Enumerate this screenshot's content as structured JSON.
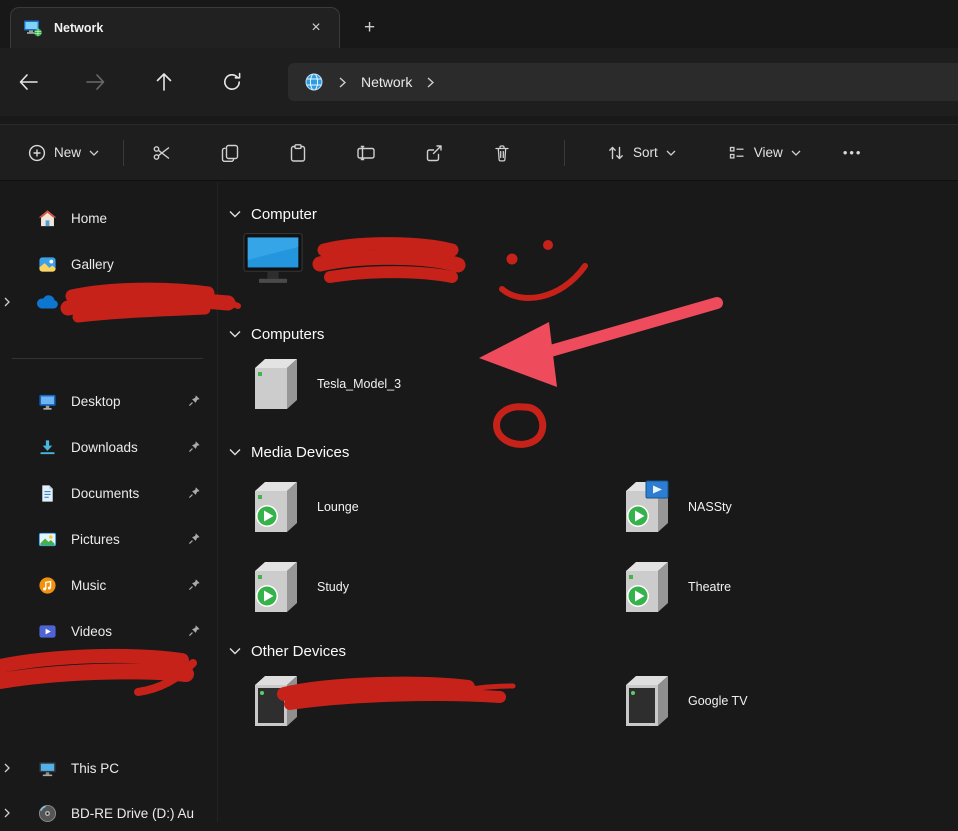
{
  "colors": {
    "annotation_red": "#c6221a",
    "annotation_pink": "#ee4c5c",
    "accent_blue": "#2496dd",
    "window_bg": "#191919"
  },
  "tab_bar": {
    "tab_title": "Network",
    "close_glyph": "×",
    "new_tab_glyph": "+"
  },
  "nav_bar": {
    "breadcrumb": {
      "current": "Network"
    }
  },
  "toolbar": {
    "new_label": "New",
    "sort_label": "Sort",
    "view_label": "View",
    "more_glyph": "•••"
  },
  "sidebar": {
    "items": [
      {
        "label": "Home",
        "icon": "home-icon",
        "pinned": false
      },
      {
        "label": "Gallery",
        "icon": "gallery-icon",
        "pinned": false
      },
      {
        "label": "",
        "icon": "onedrive-cloud-icon",
        "redacted": true
      },
      {
        "label": "Desktop",
        "icon": "desktop-icon",
        "pinned": true
      },
      {
        "label": "Downloads",
        "icon": "downloads-icon",
        "pinned": true
      },
      {
        "label": "Documents",
        "icon": "documents-icon",
        "pinned": true
      },
      {
        "label": "Pictures",
        "icon": "pictures-icon",
        "pinned": true
      },
      {
        "label": "Music",
        "icon": "music-icon",
        "pinned": true
      },
      {
        "label": "Videos",
        "icon": "videos-icon",
        "pinned": true
      },
      {
        "label": "",
        "icon": "",
        "redacted": true
      },
      {
        "label": "This PC",
        "icon": "this-pc-icon",
        "pinned": false
      },
      {
        "label": "BD-RE Drive (D:) Au",
        "icon": "disc-icon",
        "pinned": false
      }
    ]
  },
  "content": {
    "sections": [
      {
        "title": "Computer",
        "items": [
          {
            "label": "",
            "icon": "monitor-icon",
            "redacted": true
          }
        ]
      },
      {
        "title": "Computers",
        "items": [
          {
            "label": "Tesla_Model_3",
            "icon": "server-icon"
          }
        ]
      },
      {
        "title": "Media Devices",
        "items": [
          {
            "label": "Lounge",
            "icon": "media-device-icon"
          },
          {
            "label": "NASSty",
            "icon": "media-server-icon"
          },
          {
            "label": "Study",
            "icon": "media-device-icon"
          },
          {
            "label": "Theatre",
            "icon": "media-device-icon"
          }
        ]
      },
      {
        "title": "Other Devices",
        "items": [
          {
            "label": "",
            "icon": "other-device-icon",
            "redacted": true
          },
          {
            "label": "Google TV",
            "icon": "other-device-icon"
          }
        ]
      }
    ]
  },
  "annotations": {
    "items": [
      "scribble-over-onedrive-name",
      "scribble-over-computer-name",
      "smiley-doodle",
      "arrow-pointing-at-tesla-model-3",
      "circle-doodle",
      "scribble-over-sidebar-item",
      "scribble-over-other-device-name"
    ]
  }
}
